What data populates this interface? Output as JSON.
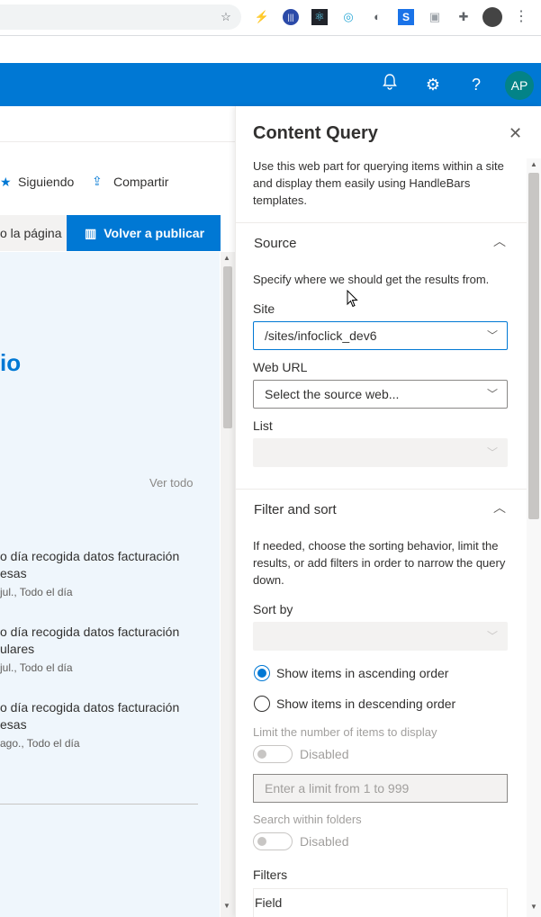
{
  "browser": {
    "extensions": [
      "extension-bolt",
      "extension-circle-bars",
      "extension-react",
      "extension-dot",
      "extension-half-circle",
      "extension-s",
      "extension-camera",
      "extension-puzzle"
    ],
    "menu_icon": "more-vert"
  },
  "suitebar": {
    "avatar_initials": "AP",
    "accent": "#0078d4"
  },
  "page": {
    "following_label": "Siguiendo",
    "share_label": "Compartir",
    "page_button_label": "o la página",
    "republish_label": "Volver a publicar",
    "heading_fragment": "io",
    "see_all_label": "Ver todo",
    "news": [
      {
        "title_line1": "o día recogida datos facturación",
        "title_line2": "esas",
        "date": "jul., Todo el día"
      },
      {
        "title_line1": "o día recogida datos facturación",
        "title_line2": "ulares",
        "date": "jul., Todo el día"
      },
      {
        "title_line1": "o día recogida datos facturación",
        "title_line2": "esas",
        "date": "ago., Todo el día"
      }
    ]
  },
  "panel": {
    "title": "Content Query",
    "description": "Use this web part for querying items within a site and display them easily using HandleBars templates.",
    "source": {
      "heading": "Source",
      "description": "Specify where we should get the results from.",
      "site_label": "Site",
      "site_value": "/sites/infoclick_dev6",
      "web_url_label": "Web URL",
      "web_url_placeholder": "Select the source web...",
      "list_label": "List",
      "list_value": ""
    },
    "filter": {
      "heading": "Filter and sort",
      "description": "If needed, choose the sorting behavior, limit the results, or add filters in order to narrow the query down.",
      "sort_by_label": "Sort by",
      "sort_by_value": "",
      "ascending_label": "Show items in ascending order",
      "descending_label": "Show items in descending order",
      "limit_label": "Limit the number of items to display",
      "limit_toggle_label": "Disabled",
      "limit_placeholder": "Enter a limit from 1 to 999",
      "folders_label": "Search within folders",
      "folders_toggle_label": "Disabled",
      "filters_label": "Filters",
      "field_label": "Field"
    }
  }
}
